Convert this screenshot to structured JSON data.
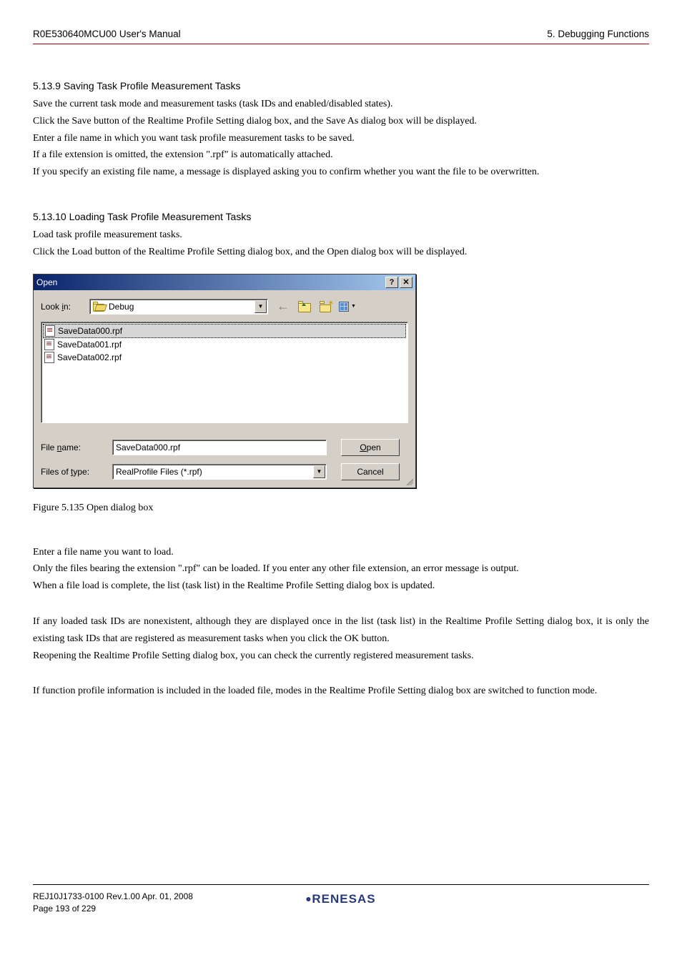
{
  "header": {
    "left": "R0E530640MCU00 User's Manual",
    "right": "5. Debugging Functions"
  },
  "section1": {
    "heading": "5.13.9   Saving Task Profile Measurement Tasks",
    "p1": "Save the current task mode and measurement tasks (task IDs and enabled/disabled states).",
    "p2": "Click the Save button of the Realtime Profile Setting dialog box, and the Save As dialog box will be displayed.",
    "p3": "Enter a file name in which you want task profile measurement tasks to be saved.",
    "p4": "If a file extension is omitted, the extension \".rpf\" is automatically attached.",
    "p5": "If you specify an existing file name, a message is displayed asking you to confirm whether you want the file to be overwritten."
  },
  "section2": {
    "heading": "5.13.10 Loading Task Profile Measurement Tasks",
    "p1": "Load task profile measurement tasks.",
    "p2": "Click the Load button of the Realtime Profile Setting dialog box, and the Open dialog box will be displayed."
  },
  "dialog": {
    "title": "Open",
    "lookInLabel": "Look ",
    "lookInLabel_u": "i",
    "lookInLabel_after": "n:",
    "lookInValue": "Debug",
    "files": [
      "SaveData000.rpf",
      "SaveData001.rpf",
      "SaveData002.rpf"
    ],
    "fileNameLabel": "File ",
    "fileNameLabel_u": "n",
    "fileNameLabel_after": "ame:",
    "fileNameValue": "SaveData000.rpf",
    "filesOfTypeLabel": "Files of ",
    "filesOfTypeLabel_u": "t",
    "filesOfTypeLabel_after": "ype:",
    "filesOfTypeValue": "RealProfile Files (*.rpf)",
    "openBtn_u": "O",
    "openBtn_after": "pen",
    "cancelBtn": "Cancel"
  },
  "figureCaption": "Figure 5.135 Open dialog box",
  "follow": {
    "p1": "Enter a file name you want to load.",
    "p2": "Only the files bearing the extension \".rpf\" can be loaded. If you enter any other file extension, an error message is output.",
    "p3": "When a file load is complete, the list (task list) in the Realtime Profile Setting dialog box is updated.",
    "p4": "If any loaded task IDs are nonexistent, although they are displayed once in the list (task list) in the Realtime Profile Setting dialog box, it is only the existing task IDs that are registered as measurement tasks when you click the OK button.",
    "p5": "Reopening the Realtime Profile Setting dialog box, you can check the currently registered measurement tasks.",
    "p6": "If function profile information is included in the loaded file, modes in the Realtime Profile Setting dialog box are switched to function mode."
  },
  "footer": {
    "line1": "REJ10J1733-0100   Rev.1.00   Apr. 01, 2008",
    "line2": "Page 193 of 229",
    "logo": "RENESAS"
  }
}
